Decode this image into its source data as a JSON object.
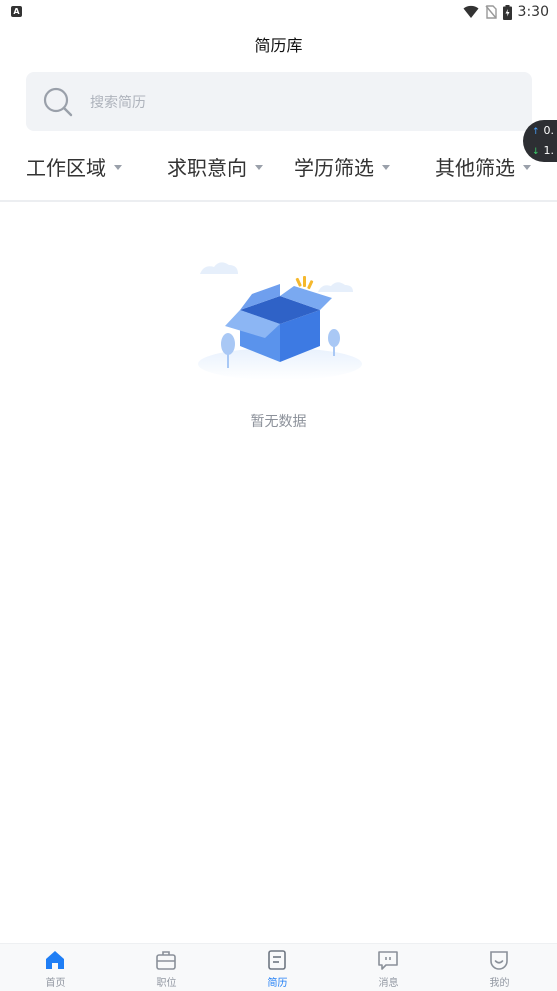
{
  "status_bar": {
    "time": "3:30",
    "app_icon": "A"
  },
  "header": {
    "title": "简历库"
  },
  "search": {
    "placeholder": "搜索简历"
  },
  "speed_badge": {
    "up": "0.",
    "down": "1."
  },
  "filters": [
    {
      "label": "工作区域"
    },
    {
      "label": "求职意向"
    },
    {
      "label": "学历筛选"
    },
    {
      "label": "其他筛选"
    }
  ],
  "empty_state": {
    "text": "暂无数据",
    "icon": "empty-box-illustration"
  },
  "tabbar": {
    "active": "简历",
    "items": [
      {
        "label": "首页",
        "icon": "home-icon"
      },
      {
        "label": "职位",
        "icon": "briefcase-icon"
      },
      {
        "label": "简历",
        "icon": "resume-icon"
      },
      {
        "label": "消息",
        "icon": "message-icon"
      },
      {
        "label": "我的",
        "icon": "profile-icon"
      }
    ]
  },
  "colors": {
    "accent": "#1f7ef5",
    "inactive": "#9298a2",
    "search_bg": "#f1f3f6"
  }
}
